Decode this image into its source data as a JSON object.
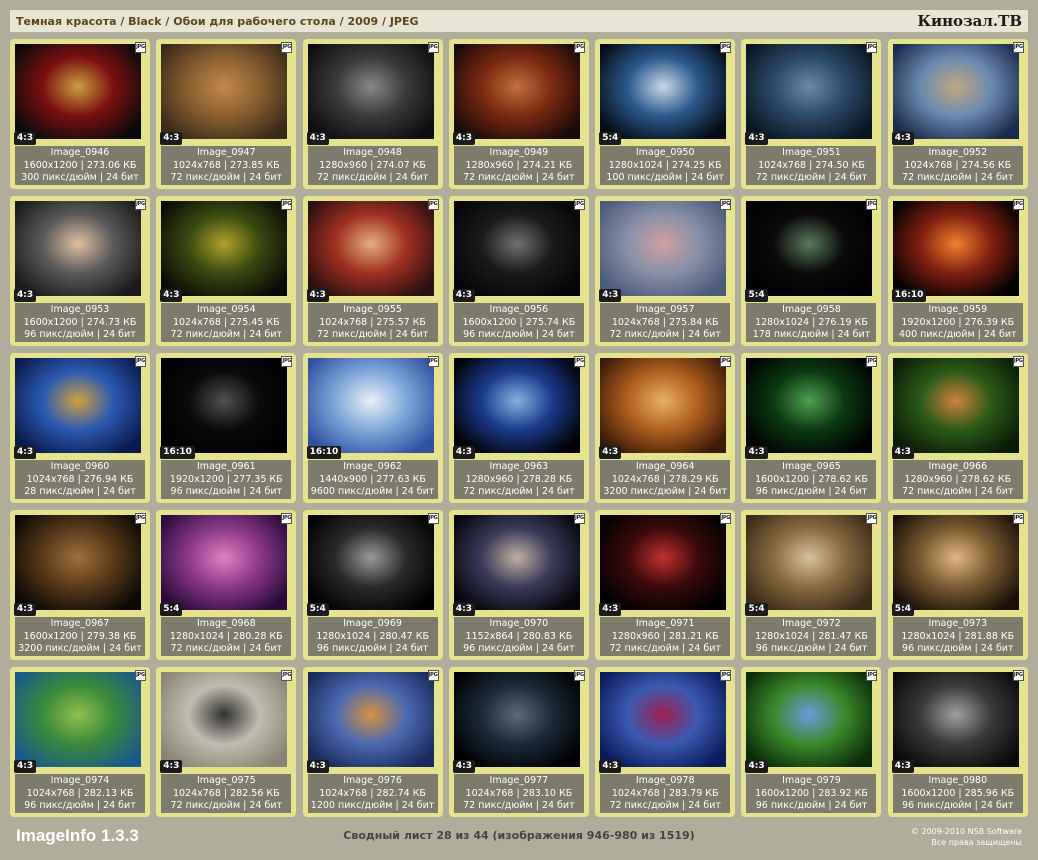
{
  "header": {
    "breadcrumb": "Темная красота / Black / Обои для рабочего стола / 2009 / JPEG",
    "site_title": "Кинозал.ТВ"
  },
  "images": [
    {
      "name": "Image_0946",
      "res": "1600x1200",
      "size": "273.06 КБ",
      "dpi": "300 пикс/дюйм",
      "bits": "24 бит",
      "ratio": "4:3",
      "colors": [
        "#0a0a0a",
        "#7a1010",
        "#c9a040"
      ]
    },
    {
      "name": "Image_0947",
      "res": "1024x768",
      "size": "273.85 КБ",
      "dpi": "72 пикс/дюйм",
      "bits": "24 бит",
      "ratio": "4:3",
      "colors": [
        "#3a2a18",
        "#8a6030",
        "#c08850"
      ]
    },
    {
      "name": "Image_0948",
      "res": "1280x960",
      "size": "274.07 КБ",
      "dpi": "72 пикс/дюйм",
      "bits": "24 бит",
      "ratio": "4:3",
      "colors": [
        "#0d0d0d",
        "#3a3a3a",
        "#888888"
      ]
    },
    {
      "name": "Image_0949",
      "res": "1280x960",
      "size": "274.21 КБ",
      "dpi": "72 пикс/дюйм",
      "bits": "24 бит",
      "ratio": "4:3",
      "colors": [
        "#1a0a08",
        "#7a2a10",
        "#c07040"
      ]
    },
    {
      "name": "Image_0950",
      "res": "1280x1024",
      "size": "274.25 КБ",
      "dpi": "100 пикс/дюйм",
      "bits": "24 бит",
      "ratio": "5:4",
      "colors": [
        "#050a15",
        "#2a5a8a",
        "#c8d8e8"
      ]
    },
    {
      "name": "Image_0951",
      "res": "1024x768",
      "size": "274.50 КБ",
      "dpi": "72 пикс/дюйм",
      "bits": "24 бит",
      "ratio": "4:3",
      "colors": [
        "#0a1520",
        "#2a4a6a",
        "#6a8aa8"
      ]
    },
    {
      "name": "Image_0952",
      "res": "1024x768",
      "size": "274.56 КБ",
      "dpi": "72 пикс/дюйм",
      "bits": "24 бит",
      "ratio": "4:3",
      "colors": [
        "#1a2a4a",
        "#6a8ab0",
        "#c0a880"
      ]
    },
    {
      "name": "Image_0953",
      "res": "1600x1200",
      "size": "274.73 КБ",
      "dpi": "96 пикс/дюйм",
      "bits": "24 бит",
      "ratio": "4:3",
      "colors": [
        "#1a1a1a",
        "#5a5a5a",
        "#e0c0a0"
      ]
    },
    {
      "name": "Image_0954",
      "res": "1024x768",
      "size": "275.45 КБ",
      "dpi": "72 пикс/дюйм",
      "bits": "24 бит",
      "ratio": "4:3",
      "colors": [
        "#0a0a05",
        "#3a4a10",
        "#b0a030"
      ]
    },
    {
      "name": "Image_0955",
      "res": "1024x768",
      "size": "275.57 КБ",
      "dpi": "72 пикс/дюйм",
      "bits": "24 бит",
      "ratio": "4:3",
      "colors": [
        "#2a1010",
        "#a03020",
        "#e0b080"
      ]
    },
    {
      "name": "Image_0956",
      "res": "1600x1200",
      "size": "275.74 КБ",
      "dpi": "96 пикс/дюйм",
      "bits": "24 бит",
      "ratio": "4:3",
      "colors": [
        "#050505",
        "#1a1a1a",
        "#707070"
      ]
    },
    {
      "name": "Image_0957",
      "res": "1024x768",
      "size": "275.84 КБ",
      "dpi": "72 пикс/дюйм",
      "bits": "24 бит",
      "ratio": "4:3",
      "colors": [
        "#4a5a7a",
        "#8a90a8",
        "#d0a0a0"
      ]
    },
    {
      "name": "Image_0958",
      "res": "1280x1024",
      "size": "276.19 КБ",
      "dpi": "178 пикс/дюйм",
      "bits": "24 бит",
      "ratio": "5:4",
      "colors": [
        "#000000",
        "#0a0a0a",
        "#5a7a5a"
      ]
    },
    {
      "name": "Image_0959",
      "res": "1920x1200",
      "size": "276.39 КБ",
      "dpi": "400 пикс/дюйм",
      "bits": "24 бит",
      "ratio": "16:10",
      "colors": [
        "#000000",
        "#802010",
        "#f08030"
      ]
    },
    {
      "name": "Image_0960",
      "res": "1024x768",
      "size": "276.94 КБ",
      "dpi": "28 пикс/дюйм",
      "bits": "24 бит",
      "ratio": "4:3",
      "colors": [
        "#0a1a4a",
        "#2a5ab0",
        "#d0a040"
      ]
    },
    {
      "name": "Image_0961",
      "res": "1920x1200",
      "size": "277.35 КБ",
      "dpi": "96 пикс/дюйм",
      "bits": "24 бит",
      "ratio": "16:10",
      "colors": [
        "#000000",
        "#0a0a0a",
        "#505050"
      ]
    },
    {
      "name": "Image_0962",
      "res": "1440x900",
      "size": "277.63 КБ",
      "dpi": "9600 пикс/дюйм",
      "bits": "24 бит",
      "ratio": "16:10",
      "colors": [
        "#3050a0",
        "#80a8d8",
        "#e8f0f8"
      ]
    },
    {
      "name": "Image_0963",
      "res": "1280x960",
      "size": "278.28 КБ",
      "dpi": "72 пикс/дюйм",
      "bits": "24 бит",
      "ratio": "4:3",
      "colors": [
        "#000000",
        "#1a3a8a",
        "#8ab0e0"
      ]
    },
    {
      "name": "Image_0964",
      "res": "1024x768",
      "size": "278.29 КБ",
      "dpi": "3200 пикс/дюйм",
      "bits": "24 бит",
      "ratio": "4:3",
      "colors": [
        "#3a1a08",
        "#b06020",
        "#e8b060"
      ]
    },
    {
      "name": "Image_0965",
      "res": "1600x1200",
      "size": "278.62 КБ",
      "dpi": "96 пикс/дюйм",
      "bits": "24 бит",
      "ratio": "4:3",
      "colors": [
        "#000000",
        "#0a3a10",
        "#50a050"
      ]
    },
    {
      "name": "Image_0966",
      "res": "1280x960",
      "size": "278.62 КБ",
      "dpi": "72 пикс/дюйм",
      "bits": "24 бит",
      "ratio": "4:3",
      "colors": [
        "#0a1a05",
        "#2a5a18",
        "#d08040"
      ]
    },
    {
      "name": "Image_0967",
      "res": "1600x1200",
      "size": "279.38 КБ",
      "dpi": "3200 пикс/дюйм",
      "bits": "24 бит",
      "ratio": "4:3",
      "colors": [
        "#0a0805",
        "#5a3a18",
        "#a07040"
      ]
    },
    {
      "name": "Image_0968",
      "res": "1280x1024",
      "size": "280.28 КБ",
      "dpi": "72 пикс/дюйм",
      "bits": "24 бит",
      "ratio": "5:4",
      "colors": [
        "#2a0a3a",
        "#8a3a8a",
        "#e080c0"
      ]
    },
    {
      "name": "Image_0969",
      "res": "1280x1024",
      "size": "280.47 КБ",
      "dpi": "96 пикс/дюйм",
      "bits": "24 бит",
      "ratio": "5:4",
      "colors": [
        "#000000",
        "#2a2a2a",
        "#9a9a9a"
      ]
    },
    {
      "name": "Image_0970",
      "res": "1152x864",
      "size": "280.83 КБ",
      "dpi": "96 пикс/дюйм",
      "bits": "24 бит",
      "ratio": "4:3",
      "colors": [
        "#05050a",
        "#3a3a5a",
        "#c0b0a0"
      ]
    },
    {
      "name": "Image_0971",
      "res": "1280x960",
      "size": "281.21 КБ",
      "dpi": "72 пикс/дюйм",
      "bits": "24 бит",
      "ratio": "4:3",
      "colors": [
        "#000000",
        "#3a0a0a",
        "#c03030"
      ]
    },
    {
      "name": "Image_0972",
      "res": "1280x1024",
      "size": "281.47 КБ",
      "dpi": "96 пикс/дюйм",
      "bits": "24 бит",
      "ratio": "5:4",
      "colors": [
        "#3a2a18",
        "#8a6a40",
        "#d8c0a0"
      ]
    },
    {
      "name": "Image_0973",
      "res": "1280x1024",
      "size": "281.88 КБ",
      "dpi": "96 пикс/дюйм",
      "bits": "24 бит",
      "ratio": "5:4",
      "colors": [
        "#1a1008",
        "#7a5a30",
        "#e0b880"
      ]
    },
    {
      "name": "Image_0974",
      "res": "1024x768",
      "size": "282.13 КБ",
      "dpi": "96 пикс/дюйм",
      "bits": "24 бит",
      "ratio": "4:3",
      "colors": [
        "#1a5a8a",
        "#3a8a3a",
        "#90c050"
      ]
    },
    {
      "name": "Image_0975",
      "res": "1024x768",
      "size": "282.56 КБ",
      "dpi": "72 пикс/дюйм",
      "bits": "24 бит",
      "ratio": "4:3",
      "colors": [
        "#8a8478",
        "#c0bcb0",
        "#303030"
      ]
    },
    {
      "name": "Image_0976",
      "res": "1024x768",
      "size": "282.74 КБ",
      "dpi": "1200 пикс/дюйм",
      "bits": "24 бит",
      "ratio": "4:3",
      "colors": [
        "#1a2a5a",
        "#4a6ab0",
        "#d89040"
      ]
    },
    {
      "name": "Image_0977",
      "res": "1024x768",
      "size": "283.10 КБ",
      "dpi": "72 пикс/дюйм",
      "bits": "24 бит",
      "ratio": "4:3",
      "colors": [
        "#000000",
        "#1a2a3a",
        "#5a6a7a"
      ]
    },
    {
      "name": "Image_0978",
      "res": "1024x768",
      "size": "283.79 КБ",
      "dpi": "72 пикс/дюйм",
      "bits": "24 бит",
      "ratio": "4:3",
      "colors": [
        "#0a1a5a",
        "#3a5ab0",
        "#a02050"
      ]
    },
    {
      "name": "Image_0979",
      "res": "1600x1200",
      "size": "283.92 КБ",
      "dpi": "96 пикс/дюйм",
      "bits": "24 бит",
      "ratio": "4:3",
      "colors": [
        "#0a2a08",
        "#3a8a2a",
        "#6a9ae0"
      ]
    },
    {
      "name": "Image_0980",
      "res": "1600x1200",
      "size": "285.96 КБ",
      "dpi": "96 пикс/дюйм",
      "bits": "24 бит",
      "ratio": "4:3",
      "colors": [
        "#0a0a0a",
        "#3a3a3a",
        "#a0a0a0"
      ]
    }
  ],
  "badge_text": "JPG",
  "footer": {
    "app_name": "ImageInfo 1.3.3",
    "summary": "Сводный лист 28 из 44 (изображения 946-980 из 1519)",
    "copyright": "© 2009-2010 NSB Software",
    "rights": "Все права защищены"
  }
}
